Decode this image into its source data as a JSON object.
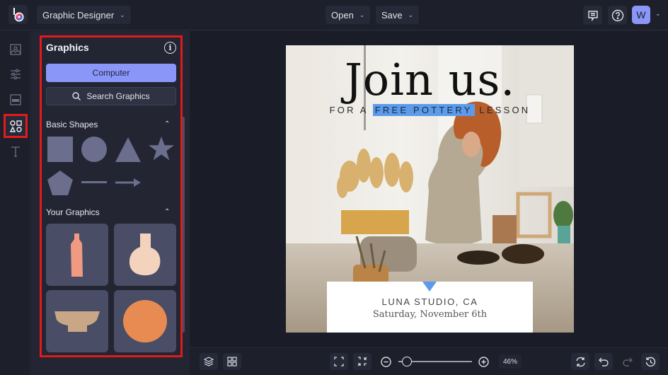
{
  "topbar": {
    "app_menu_label": "Graphic Designer",
    "open_label": "Open",
    "save_label": "Save",
    "avatar_initial": "W",
    "icons": [
      "logo-icon",
      "feedback-icon",
      "help-icon",
      "chevron-down-icon"
    ]
  },
  "leftrail": {
    "items": [
      {
        "name": "photos",
        "icon": "image-icon",
        "active": false
      },
      {
        "name": "adjust",
        "icon": "sliders-icon",
        "active": false
      },
      {
        "name": "layouts",
        "icon": "layout-icon",
        "active": false
      },
      {
        "name": "graphics",
        "icon": "shapes-icon",
        "active": true
      },
      {
        "name": "text",
        "icon": "text-icon",
        "active": false
      }
    ]
  },
  "panel": {
    "title": "Graphics",
    "computer_label": "Computer",
    "search_label": "Search Graphics",
    "basic_shapes_label": "Basic Shapes",
    "your_graphics_label": "Your Graphics",
    "basic_shapes": [
      "square",
      "circle",
      "triangle",
      "star",
      "pentagon",
      "line",
      "arrow"
    ],
    "your_graphics": [
      "bottle-vase",
      "round-vase",
      "bowl",
      "orange-circle"
    ],
    "colors": {
      "shape": "#6b6e8c",
      "bottle": "#f19a82",
      "round_vase": "#f3d3bd",
      "bowl": "#c9a786",
      "circle": "#e88b52",
      "accent": "#8a97f8",
      "highlight_frame": "#e11a1a"
    }
  },
  "design": {
    "headline": "Join us.",
    "sub_prefix": "FOR A",
    "sub_highlight": "FREE POTTERY",
    "sub_suffix": "LESSON",
    "location": "LUNA STUDIO, CA",
    "date": "Saturday, November 6th",
    "highlight_color": "#5b9bea"
  },
  "bottombar": {
    "zoom_percent": "46%",
    "zoom_level": 0.05
  }
}
